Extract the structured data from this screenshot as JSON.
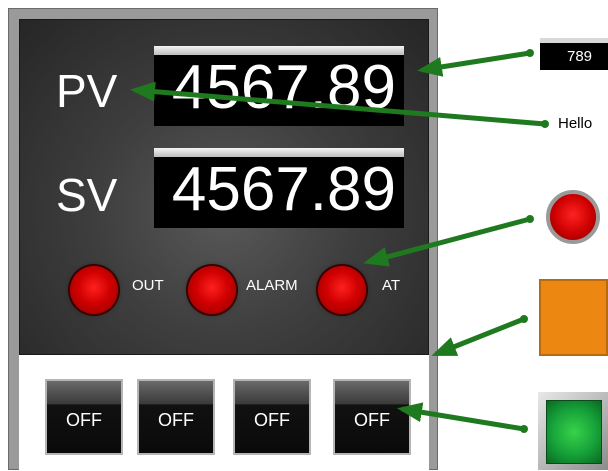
{
  "panel": {
    "pv_label": "PV",
    "sv_label": "SV",
    "pv_value": "4567.89",
    "sv_value": "4567.89",
    "indicators": [
      {
        "label": "OUT"
      },
      {
        "label": "ALARM"
      },
      {
        "label": "AT"
      }
    ],
    "buttons": [
      {
        "label": "OFF"
      },
      {
        "label": "OFF"
      },
      {
        "label": "OFF"
      },
      {
        "label": "OFF"
      }
    ]
  },
  "widgets": {
    "numeric_display": "789",
    "text_label": "Hello"
  },
  "colors": {
    "arrow": "#1f7a1f",
    "led_red": "#e00000",
    "orange": "#ec8812",
    "green": "#22b33a"
  }
}
